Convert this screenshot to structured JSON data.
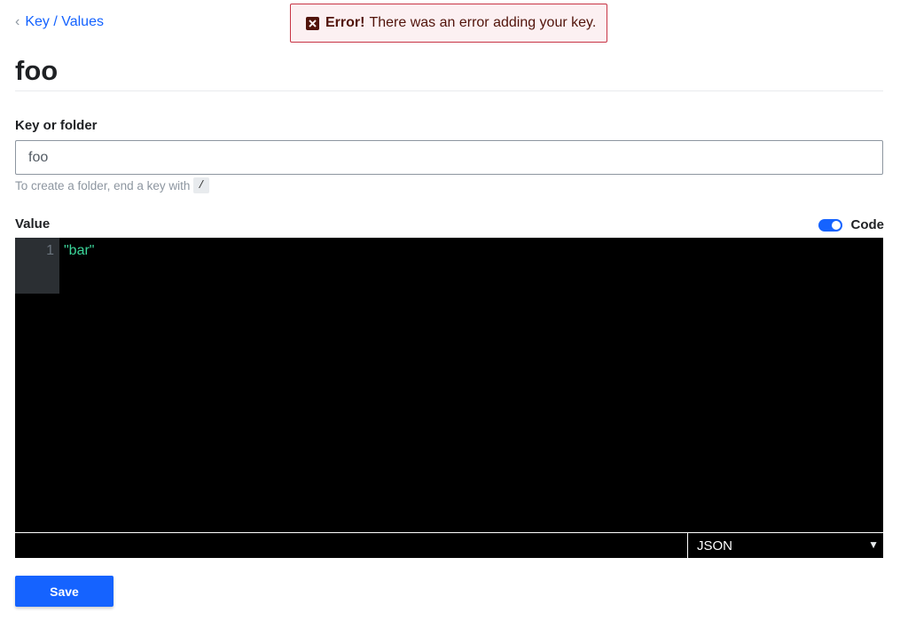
{
  "breadcrumb": {
    "label": "Key / Values"
  },
  "alert": {
    "title": "Error!",
    "message": "There was an error adding your key."
  },
  "page": {
    "title": "foo"
  },
  "key_field": {
    "label": "Key or folder",
    "value": "foo",
    "help": "To create a folder, end a key with",
    "help_code": "/"
  },
  "value_field": {
    "label": "Value",
    "code_toggle_label": "Code",
    "code_toggle_on": true,
    "line_number": "1",
    "code": "\"bar\"",
    "mode": "JSON"
  },
  "actions": {
    "save_label": "Save"
  },
  "colors": {
    "accent": "#1563ff",
    "error": "#c73445",
    "code_string": "#3bd69a"
  },
  "icons": {
    "breadcrumb": "chevron-left-icon",
    "alert": "error-x-icon",
    "select": "caret-down-icon"
  }
}
